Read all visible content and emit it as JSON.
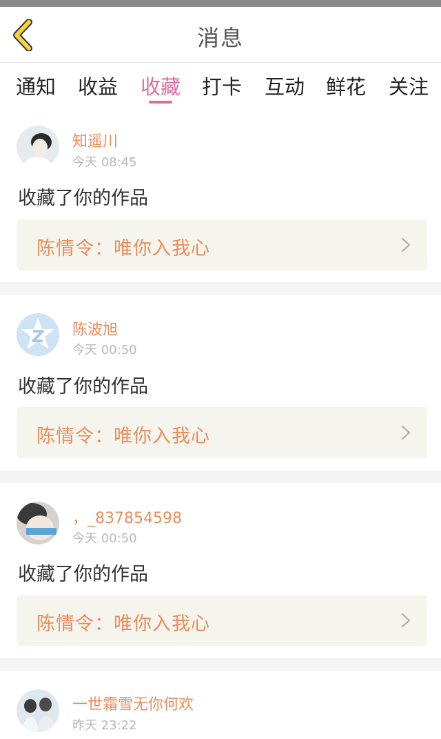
{
  "header": {
    "title": "消息"
  },
  "tabs": [
    {
      "label": "通知",
      "active": false
    },
    {
      "label": "收益",
      "active": false
    },
    {
      "label": "收藏",
      "active": true
    },
    {
      "label": "打卡",
      "active": false
    },
    {
      "label": "互动",
      "active": false
    },
    {
      "label": "鲜花",
      "active": false
    },
    {
      "label": "关注",
      "active": false
    }
  ],
  "colors": {
    "accent": "#e06c9f",
    "username": "#ec8c5a",
    "work_bg": "#f5f5ee"
  },
  "messages": [
    {
      "username": "知遥川",
      "time": "今天 08:45",
      "action": "收藏了你的作品",
      "work_title": "陈情令：唯你入我心"
    },
    {
      "username": "陈波旭",
      "time": "今天 00:50",
      "action": "收藏了你的作品",
      "work_title": "陈情令：唯你入我心"
    },
    {
      "username": "，_837854598",
      "time": "今天 00:50",
      "action": "收藏了你的作品",
      "work_title": "陈情令：唯你入我心"
    },
    {
      "username": "一世霜雪无你何欢",
      "time": "昨天 23:22"
    }
  ]
}
